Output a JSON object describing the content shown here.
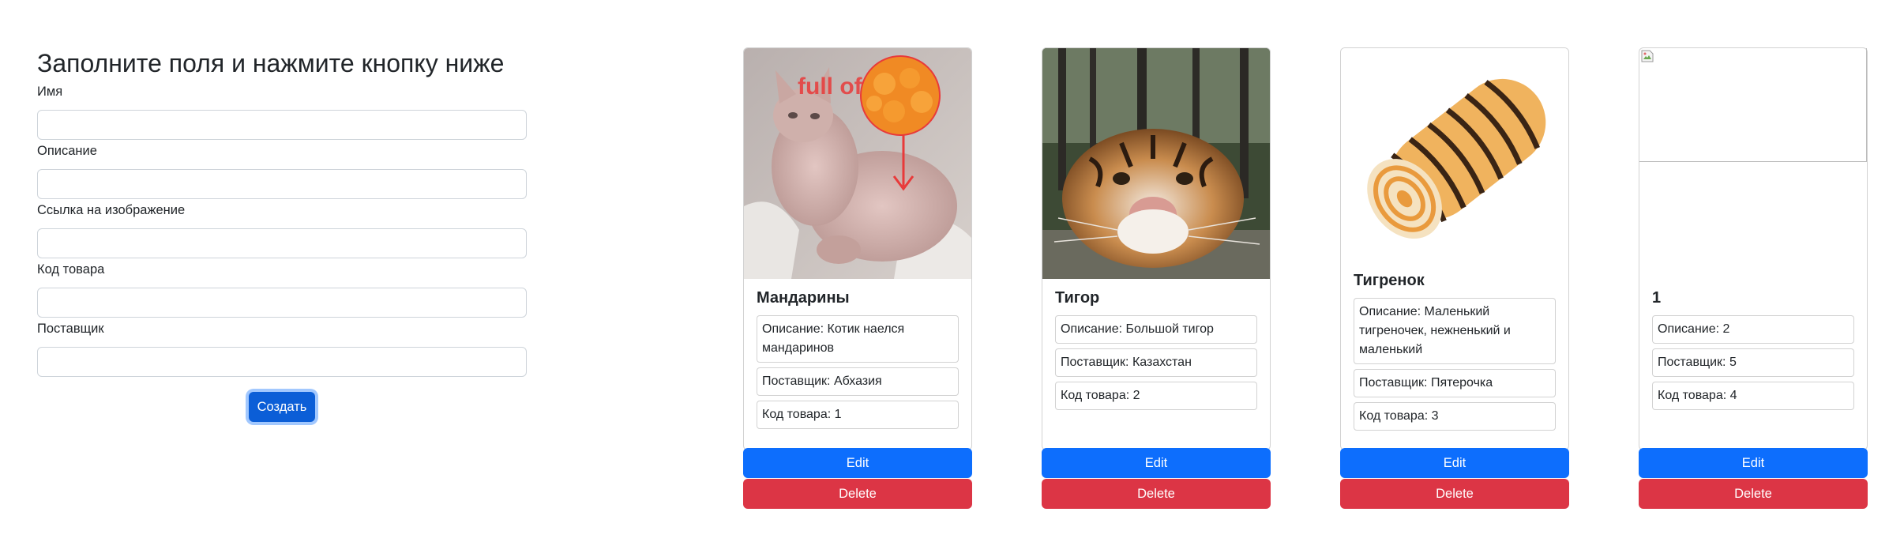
{
  "form": {
    "heading": "Заполните поля и нажмите кнопку ниже",
    "fields": [
      {
        "label": "Имя",
        "value": ""
      },
      {
        "label": "Описание",
        "value": ""
      },
      {
        "label": "Ссылка на изображение",
        "value": ""
      },
      {
        "label": "Код товара",
        "value": ""
      },
      {
        "label": "Поставщик",
        "value": ""
      }
    ],
    "submit_label": "Создать"
  },
  "cards": [
    {
      "title": "Мандарины",
      "description": "Описание: Котик наелся мандаринов",
      "supplier": "Поставщик: Абхазия",
      "code": "Код товара: 1",
      "image_text": "full of:",
      "edit_label": "Edit",
      "delete_label": "Delete"
    },
    {
      "title": "Тигор",
      "description": "Описание: Большой тигор",
      "supplier": "Поставщик: Казахстан",
      "code": "Код товара: 2",
      "edit_label": "Edit",
      "delete_label": "Delete"
    },
    {
      "title": "Тигренок",
      "description": "Описание: Маленький тигреночек, нежненький и маленький",
      "supplier": "Поставщик: Пятерочка",
      "code": "Код товара: 3",
      "edit_label": "Edit",
      "delete_label": "Delete"
    },
    {
      "title": "1",
      "description": "Описание: 2",
      "supplier": "Поставщик: 5",
      "code": "Код товара: 4",
      "edit_label": "Edit",
      "delete_label": "Delete"
    }
  ],
  "colors": {
    "primary": "#0d6efd",
    "primary_active": "#0b5ed7",
    "danger": "#dc3545",
    "border": "#ced4da"
  }
}
